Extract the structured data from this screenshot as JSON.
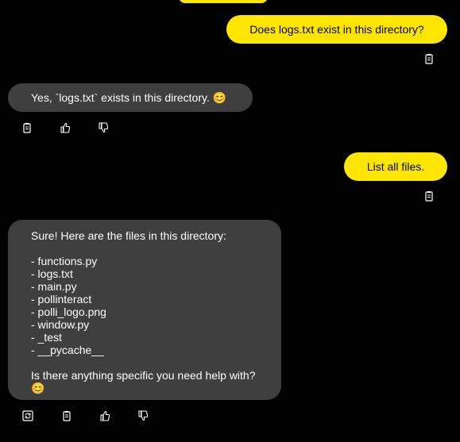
{
  "chat": {
    "messages": [
      {
        "role": "user",
        "text": "Does logs.txt exist in this directory?"
      },
      {
        "role": "assistant",
        "text": "Yes, `logs.txt` exists in this directory. 😊"
      },
      {
        "role": "user",
        "text": "List all files."
      },
      {
        "role": "assistant",
        "text": "Sure! Here are the files in this directory:\n\n- functions.py\n- logs.txt\n- main.py\n- pollinteract\n- polli_logo.png\n- window.py\n- _test\n- __pycache__\n\nIs there anything specific you need help with? 😊"
      }
    ]
  },
  "icons": {
    "copy": "copy-icon",
    "thumbs_up": "thumbs-up-icon",
    "thumbs_down": "thumbs-down-icon",
    "regenerate": "regenerate-icon"
  },
  "colors": {
    "user_bubble": "#ffe600",
    "assistant_bubble": "#3f3f3f",
    "background": "#000000"
  }
}
